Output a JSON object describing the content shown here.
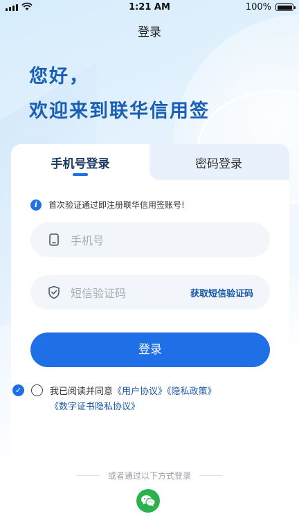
{
  "status_bar": {
    "time": "1:21 AM",
    "battery_pct": "100%",
    "icons": [
      "signal-icon",
      "wifi-icon",
      "battery-icon"
    ]
  },
  "header": {
    "title": "登录"
  },
  "greeting": {
    "line1": "您好，",
    "line2": "欢迎来到联华信用签"
  },
  "tabs": [
    {
      "label": "手机号登录",
      "active": true
    },
    {
      "label": "密码登录",
      "active": false
    }
  ],
  "hint": {
    "icon": "info-icon",
    "text": "首次验证通过即注册联华信用签账号!"
  },
  "form": {
    "phone": {
      "placeholder": "手机号",
      "value": "",
      "icon": "phone-icon"
    },
    "code": {
      "placeholder": "短信验证码",
      "value": "",
      "icon": "shield-check-icon"
    },
    "get_code_label": "获取短信验证码",
    "submit_label": "登录"
  },
  "agreement": {
    "prefix": "我已阅读并同意",
    "user_agreement": "《用户协议》",
    "privacy_policy": "《隐私政策》",
    "cert_privacy": "《数字证书隐私协议》"
  },
  "alt_login": {
    "divider_text": "或者通过以下方式登录",
    "methods": [
      "wechat-icon"
    ]
  },
  "colors": {
    "primary": "#1f6fe6",
    "heading": "#1a5fb4",
    "link": "#1a56a8",
    "wechat": "#2bb24c"
  }
}
